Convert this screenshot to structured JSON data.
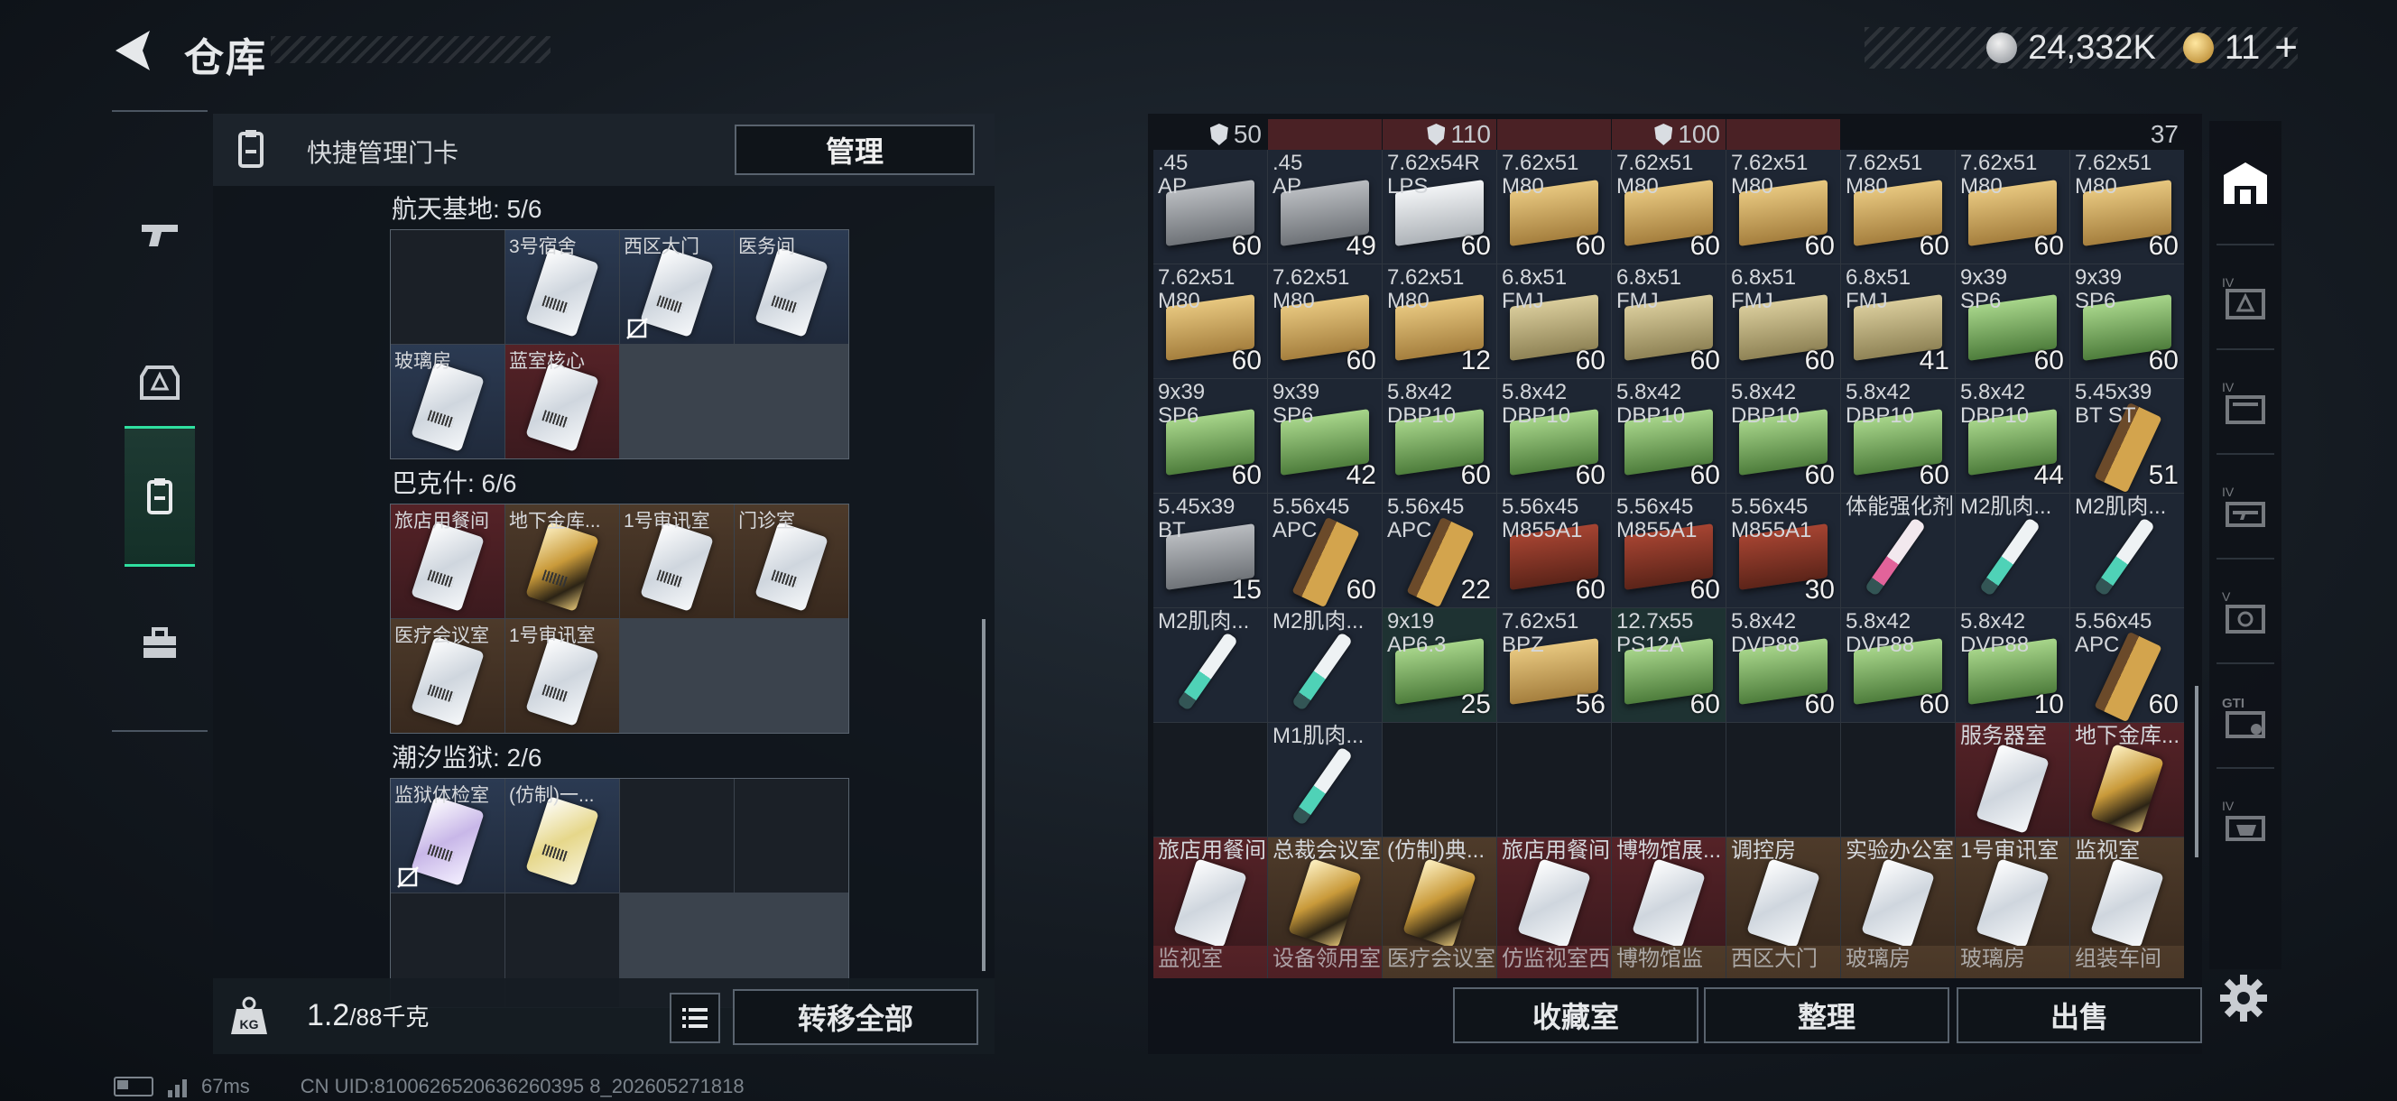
{
  "header": {
    "title": "仓库"
  },
  "currency": {
    "silver": "24,332K",
    "gold": "11"
  },
  "left_panel": {
    "title": "快捷管理门卡",
    "manage_label": "管理",
    "sections": [
      {
        "title": "航天基地: 5/6",
        "cards": [
          {
            "label": "",
            "color": "empty"
          },
          {
            "label": "3号宿舍",
            "color": "blue"
          },
          {
            "label": "西区大门",
            "color": "blue"
          },
          {
            "label": "医务间",
            "color": "blue"
          },
          {
            "label": "玻璃房",
            "color": "blue"
          },
          {
            "label": "蓝室核心",
            "color": "red"
          }
        ]
      },
      {
        "title": "巴克什: 6/6",
        "cards": [
          {
            "label": "旅店用餐间",
            "color": "red"
          },
          {
            "label": "地下金库...",
            "color": "brown"
          },
          {
            "label": "1号审讯室",
            "color": "brown"
          },
          {
            "label": "门诊室",
            "color": "brown"
          },
          {
            "label": "医疗会议室",
            "color": "brown"
          },
          {
            "label": "1号审讯室",
            "color": "brown"
          }
        ]
      },
      {
        "title": "潮汐监狱: 2/6",
        "cards": [
          {
            "label": "监狱体检室",
            "color": "blue"
          },
          {
            "label": "(仿制)一...",
            "color": "blue"
          }
        ]
      }
    ],
    "weight_value": "1.2",
    "weight_max": "/88千克",
    "transfer_label": "转移全部"
  },
  "inventory": {
    "top_row": [
      {
        "value": "50",
        "armor": true,
        "color": "dark"
      },
      {
        "value": "",
        "armor": false,
        "color": "red"
      },
      {
        "value": "110",
        "armor": true,
        "color": "red"
      },
      {
        "value": "",
        "armor": false,
        "color": "red"
      },
      {
        "value": "100",
        "armor": true,
        "color": "red"
      },
      {
        "value": "",
        "armor": false,
        "color": "red"
      },
      {
        "value": "",
        "armor": false,
        "color": "dark"
      },
      {
        "value": "",
        "armor": false,
        "color": "dark"
      },
      {
        "value": "37",
        "armor": false,
        "color": "dark"
      }
    ],
    "items": [
      {
        "label": ".45\nAP",
        "count": "60",
        "kind": "gray"
      },
      {
        "label": ".45\nAP",
        "count": "49",
        "kind": "gray"
      },
      {
        "label": "7.62x54R\nLPS",
        "count": "60",
        "kind": "white"
      },
      {
        "label": "7.62x51\nM80",
        "count": "60",
        "kind": "tan"
      },
      {
        "label": "7.62x51\nM80",
        "count": "60",
        "kind": "tan"
      },
      {
        "label": "7.62x51\nM80",
        "count": "60",
        "kind": "tan"
      },
      {
        "label": "7.62x51\nM80",
        "count": "60",
        "kind": "tan"
      },
      {
        "label": "7.62x51\nM80",
        "count": "60",
        "kind": "tan"
      },
      {
        "label": "7.62x51\nM80",
        "count": "60",
        "kind": "tan"
      },
      {
        "label": "7.62x51\nM80",
        "count": "60",
        "kind": "tan"
      },
      {
        "label": "7.62x51\nM80",
        "count": "60",
        "kind": "tan"
      },
      {
        "label": "7.62x51\nM80",
        "count": "12",
        "kind": "tan"
      },
      {
        "label": "6.8x51\nFMJ",
        "count": "60",
        "kind": "khaki"
      },
      {
        "label": "6.8x51\nFMJ",
        "count": "60",
        "kind": "khaki"
      },
      {
        "label": "6.8x51\nFMJ",
        "count": "60",
        "kind": "khaki"
      },
      {
        "label": "6.8x51\nFMJ",
        "count": "41",
        "kind": "khaki"
      },
      {
        "label": "9x39\nSP6",
        "count": "60",
        "kind": "green"
      },
      {
        "label": "9x39\nSP6",
        "count": "60",
        "kind": "green"
      },
      {
        "label": "9x39\nSP6",
        "count": "60",
        "kind": "green"
      },
      {
        "label": "9x39\nSP6",
        "count": "42",
        "kind": "green"
      },
      {
        "label": "5.8x42\nDBP10",
        "count": "60",
        "kind": "green"
      },
      {
        "label": "5.8x42\nDBP10",
        "count": "60",
        "kind": "green"
      },
      {
        "label": "5.8x42\nDBP10",
        "count": "60",
        "kind": "green"
      },
      {
        "label": "5.8x42\nDBP10",
        "count": "60",
        "kind": "green"
      },
      {
        "label": "5.8x42\nDBP10",
        "count": "60",
        "kind": "green"
      },
      {
        "label": "5.8x42\nDBP10",
        "count": "44",
        "kind": "green"
      },
      {
        "label": "5.45x39\nBT ST",
        "count": "51",
        "kind": "bullets"
      },
      {
        "label": "5.45x39\nBT",
        "count": "15",
        "kind": "gray"
      },
      {
        "label": "5.56x45\nAPC",
        "count": "60",
        "kind": "bullets"
      },
      {
        "label": "5.56x45\nAPC",
        "count": "22",
        "kind": "bullets"
      },
      {
        "label": "5.56x45\nM855A1",
        "count": "60",
        "kind": "redbox"
      },
      {
        "label": "5.56x45\nM855A1",
        "count": "60",
        "kind": "redbox"
      },
      {
        "label": "5.56x45\nM855A1",
        "count": "30",
        "kind": "redbox"
      },
      {
        "label": "体能强化剂",
        "count": "",
        "kind": "syringe-pink"
      },
      {
        "label": "M2肌肉...",
        "count": "",
        "kind": "syringe"
      },
      {
        "label": "M2肌肉...",
        "count": "",
        "kind": "syringe"
      },
      {
        "label": "M2肌肉...",
        "count": "",
        "kind": "syringe"
      },
      {
        "label": "M2肌肉...",
        "count": "",
        "kind": "syringe"
      },
      {
        "label": "9x19\nAP6.3",
        "count": "25",
        "kind": "green"
      },
      {
        "label": "7.62x51\nBPZ",
        "count": "56",
        "kind": "tan"
      },
      {
        "label": "12.7x55\nPS12A",
        "count": "60",
        "kind": "green"
      },
      {
        "label": "5.8x42\nDVP88",
        "count": "60",
        "kind": "green"
      },
      {
        "label": "5.8x42\nDVP88",
        "count": "60",
        "kind": "green"
      },
      {
        "label": "5.8x42\nDVP88",
        "count": "10",
        "kind": "green"
      },
      {
        "label": "5.56x45\nAPC",
        "count": "60",
        "kind": "bullets"
      },
      {
        "label": "",
        "count": "",
        "kind": "empty"
      },
      {
        "label": "M1肌肉...",
        "count": "",
        "kind": "syringe"
      },
      {
        "label": "",
        "count": "",
        "kind": "empty"
      },
      {
        "label": "",
        "count": "",
        "kind": "empty"
      },
      {
        "label": "",
        "count": "",
        "kind": "empty"
      },
      {
        "label": "",
        "count": "",
        "kind": "empty"
      },
      {
        "label": "",
        "count": "",
        "kind": "empty"
      },
      {
        "label": "服务器室",
        "count": "",
        "kind": "card-red"
      },
      {
        "label": "地下金库...",
        "count": "",
        "kind": "card-red-gold"
      },
      {
        "label": "旅店用餐间",
        "count": "",
        "kind": "card-red"
      },
      {
        "label": "总裁会议室",
        "count": "",
        "kind": "card-brown-gold"
      },
      {
        "label": "(仿制)典...",
        "count": "",
        "kind": "card-brown-gold"
      },
      {
        "label": "旅店用餐间",
        "count": "",
        "kind": "card-red"
      },
      {
        "label": "博物馆展...",
        "count": "",
        "kind": "card-red"
      },
      {
        "label": "调控房",
        "count": "",
        "kind": "card-brown"
      },
      {
        "label": "实验办公室",
        "count": "",
        "kind": "card-brown"
      },
      {
        "label": "1号审讯室",
        "count": "",
        "kind": "card-brown"
      },
      {
        "label": "监视室",
        "count": "",
        "kind": "card-brown"
      }
    ],
    "cutoff_labels": [
      "监视室",
      "设备领用室",
      "医疗会议室",
      "仿监视室西",
      "博物馆监",
      "西区大门",
      "玻璃房",
      "玻璃房",
      "组装车间"
    ]
  },
  "actions": {
    "collection": "收藏室",
    "organize": "整理",
    "sell": "出售"
  },
  "status": {
    "ping": "67ms",
    "uid": "CN UID:8100626520636260395 8_202605271818"
  }
}
